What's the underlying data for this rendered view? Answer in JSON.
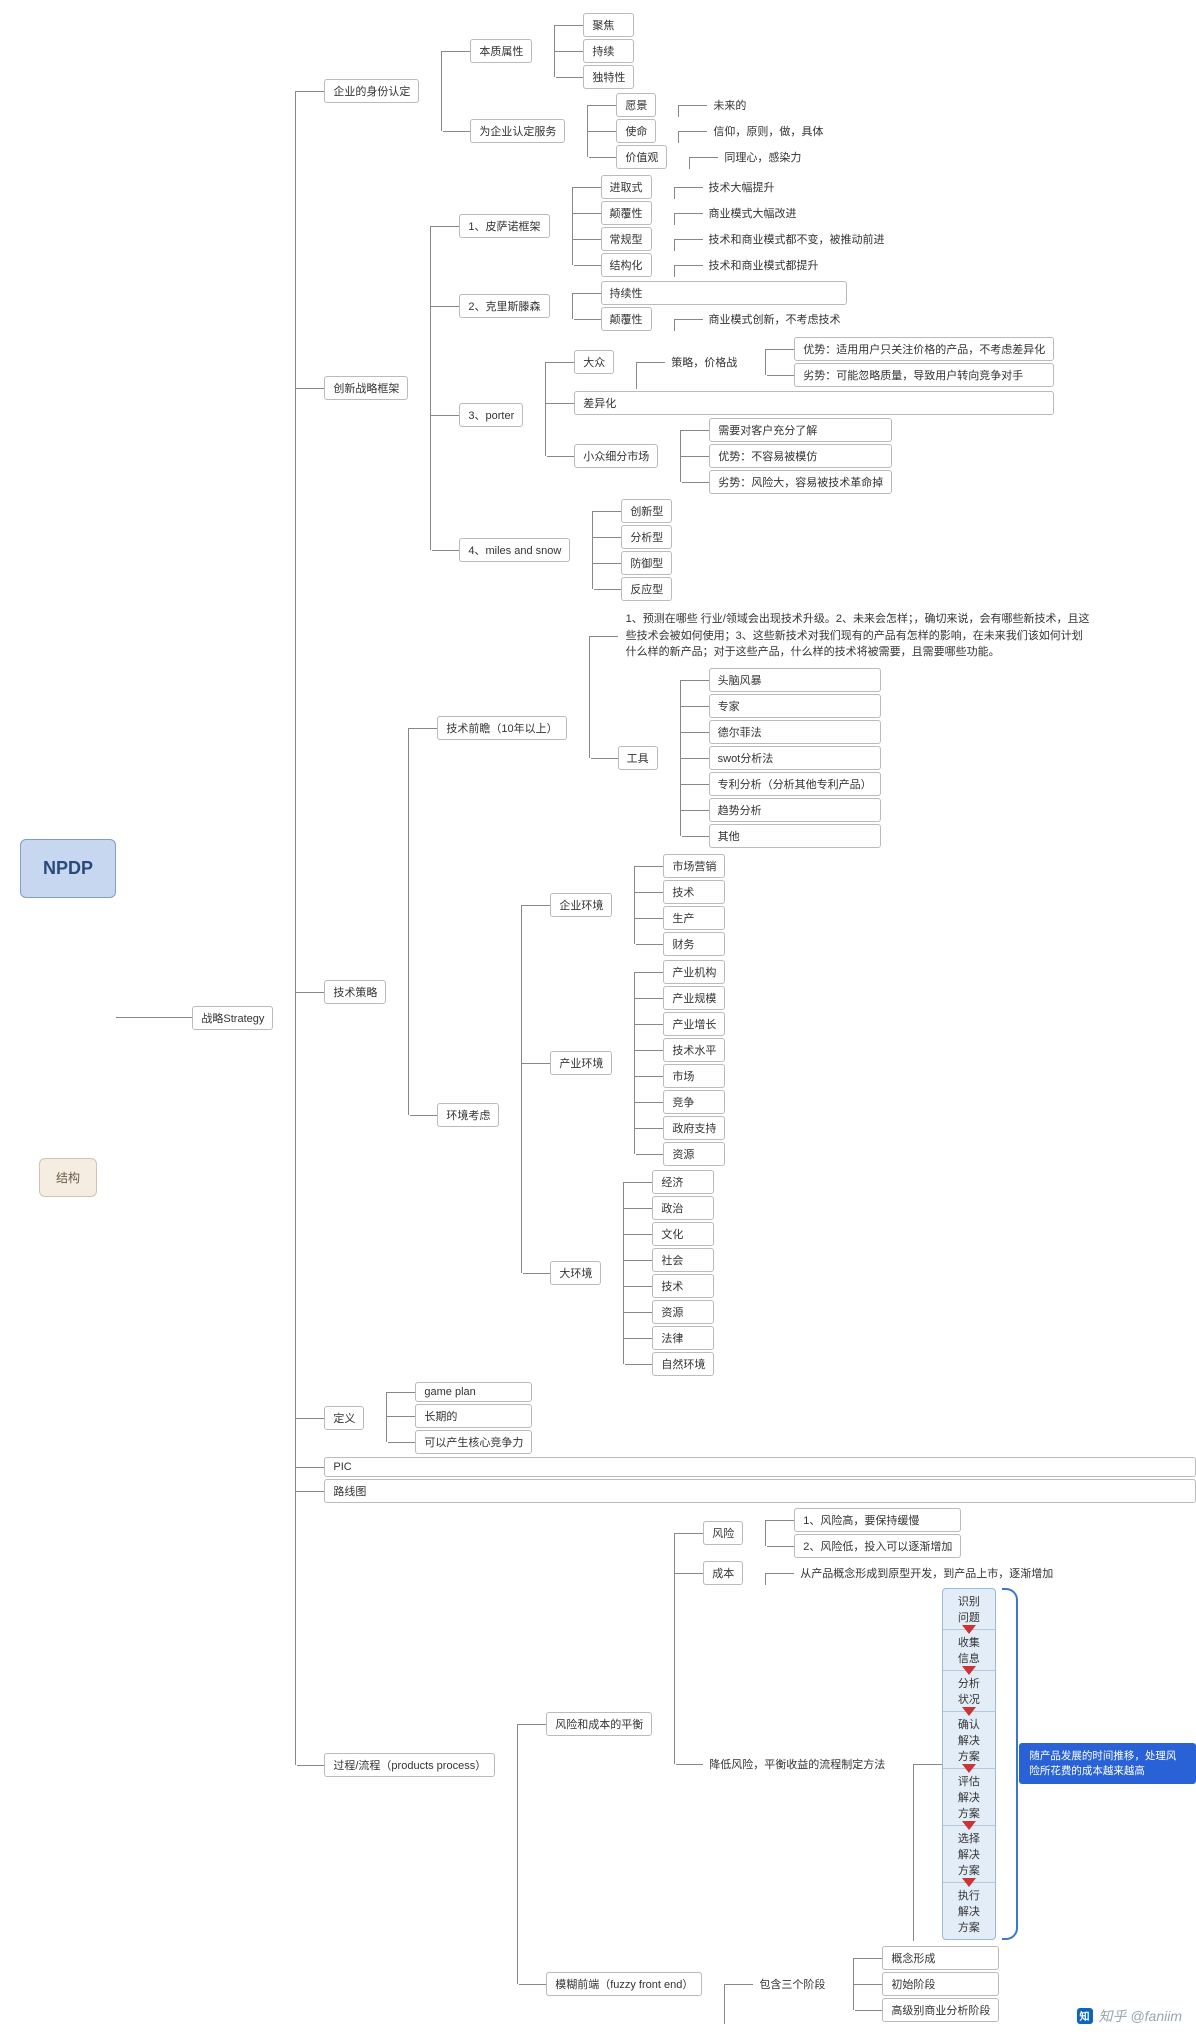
{
  "root": "NPDP",
  "sub_root": "结构",
  "strategy": "战略Strategy",
  "identity": {
    "title": "企业的身份认定",
    "essence": {
      "title": "本质属性",
      "items": [
        "聚焦",
        "持续",
        "独特性"
      ]
    },
    "service": {
      "title": "为企业认定服务",
      "vision": {
        "k": "愿景",
        "v": "未来的"
      },
      "mission": {
        "k": "使命",
        "v": "信仰，原则，做，具体"
      },
      "values": {
        "k": "价值观",
        "v": "同理心，感染力"
      }
    }
  },
  "innov": {
    "title": "创新战略框架",
    "f1": {
      "title": "1、皮萨诺框架",
      "a": {
        "k": "进取式",
        "v": "技术大幅提升"
      },
      "b": {
        "k": "颠覆性",
        "v": "商业模式大幅改进"
      },
      "c": {
        "k": "常规型",
        "v": "技术和商业模式都不变，被推动前进"
      },
      "d": {
        "k": "结构化",
        "v": "技术和商业模式都提升"
      }
    },
    "f2": {
      "title": "2、克里斯滕森",
      "a": "持续性",
      "b": {
        "k": "颠覆性",
        "v": "商业模式创新，不考虑技术"
      }
    },
    "f3": {
      "title": "3、porter",
      "mass": {
        "k": "大众",
        "strat": "策略，价格战",
        "adv": "优势：适用用户只关注价格的产品，不考虑差异化",
        "dis": "劣势：可能忽略质量，导致用户转向竞争对手"
      },
      "diff": "差异化",
      "niche": {
        "k": "小众细分市场",
        "a": "需要对客户充分了解",
        "b": "优势：不容易被模仿",
        "c": "劣势：风险大，容易被技术革命掉"
      }
    },
    "f4": {
      "title": "4、miles and snow",
      "items": [
        "创新型",
        "分析型",
        "防御型",
        "反应型"
      ]
    }
  },
  "tech": {
    "title": "技术策略",
    "foresight": {
      "title": "技术前瞻（10年以上）",
      "para": "1、预测在哪些 行业/领域会出现技术升级。2、未来会怎样；，确切来说，会有哪些新技术，且这些技术会被如何使用；3、这些新技术对我们现有的产品有怎样的影响，在未来我们该如何计划什么样的新产品；对于这些产品，什么样的技术将被需要，且需要哪些功能。",
      "tools": {
        "title": "工具",
        "items": [
          "头脑风暴",
          "专家",
          "德尔菲法",
          "swot分析法",
          "专利分析（分析其他专利产品）",
          "趋势分析",
          "其他"
        ]
      }
    },
    "env": {
      "title": "环境考虑",
      "corp": {
        "title": "企业环境",
        "items": [
          "市场营销",
          "技术",
          "生产",
          "财务"
        ]
      },
      "ind": {
        "title": "产业环境",
        "items": [
          "产业机构",
          "产业规模",
          "产业增长",
          "技术水平",
          "市场",
          "竞争",
          "政府支持",
          "资源"
        ]
      },
      "macro": {
        "title": "大环境",
        "items": [
          "经济",
          "政治",
          "文化",
          "社会",
          "技术",
          "资源",
          "法律",
          "自然环境"
        ]
      }
    }
  },
  "def": {
    "title": "定义",
    "items": [
      "game plan",
      "长期的",
      "可以产生核心竞争力"
    ]
  },
  "pic": "PIC",
  "roadmap": "路线图",
  "process": {
    "title": "过程/流程（products process）",
    "balance": {
      "title": "风险和成本的平衡",
      "risk": {
        "title": "风险",
        "a": "1、风险高，要保持缓慢",
        "b": "2、风险低，投入可以逐渐增加"
      },
      "cost": {
        "k": "成本",
        "v": "从产品概念形成到原型开发，到产品上市，逐渐增加"
      },
      "method": {
        "title": "降低风险，平衡收益的流程制定方法",
        "steps": [
          "识别问题",
          "收集信息",
          "分析状况",
          "确认解决方案",
          "评估解决方案",
          "选择解决方案",
          "执行解决方案"
        ]
      },
      "callout": "随产品发展的时间推移，处理风险所花费的成本越来越高"
    },
    "fuzzy": {
      "title": "模糊前端（fuzzy front end）",
      "stages_label": "包含三个阶段",
      "items": [
        "概念形成",
        "初始阶段",
        "高级别商业分析阶段"
      ]
    }
  },
  "watermark": "知乎 @faniim"
}
